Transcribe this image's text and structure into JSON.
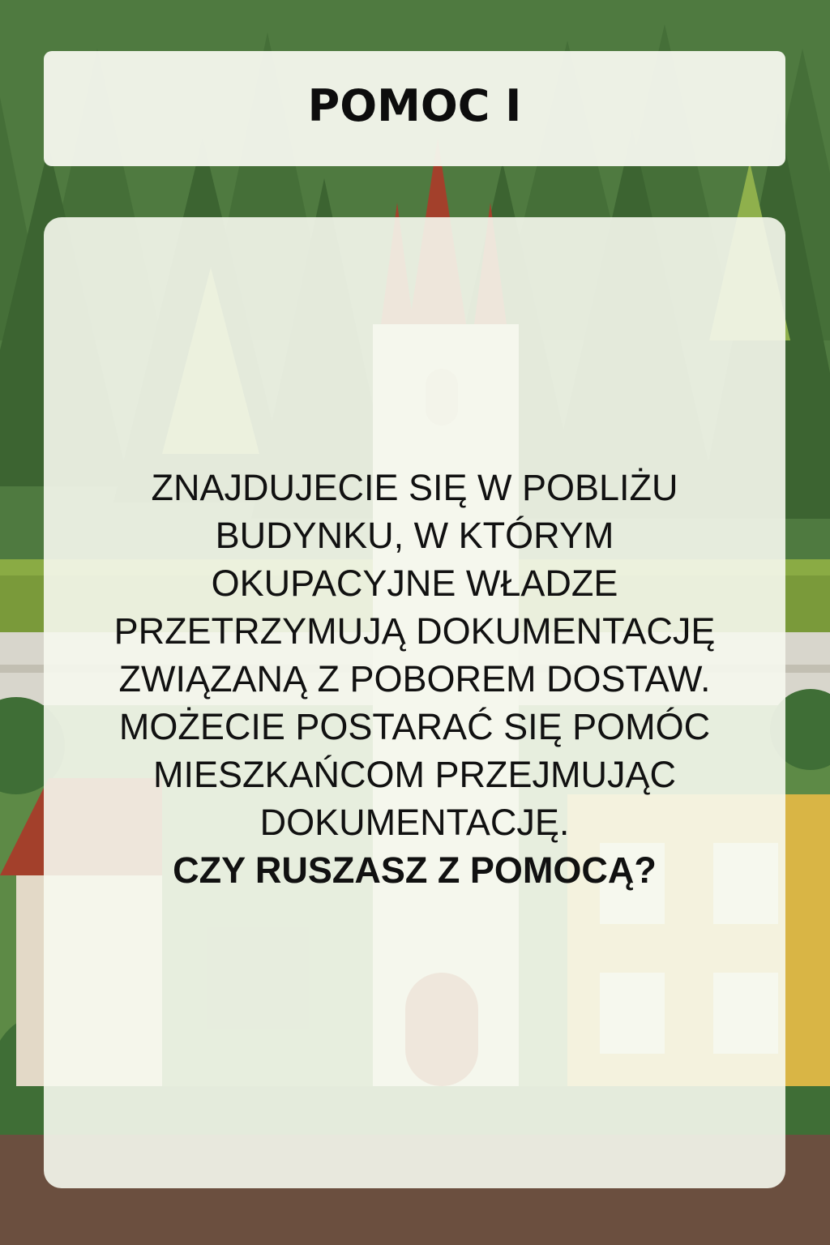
{
  "card": {
    "title": "POMOC I",
    "body": "ZNAJDUJECIE SIĘ W POBLIŻU BUDYNKU, W KTÓRYM OKUPACYJNE WŁADZE PRZETRZYMUJĄ DOKUMENTACJĘ ZWIĄZANĄ Z POBOREM DOSTAW. MOŻECIE POSTARAĆ SIĘ POMÓC MIESZKAŃCOM PRZEJMUJĄC DOKUMENTACJĘ.",
    "question": "CZY RUSZASZ Z POMOCĄ?"
  },
  "background": {
    "description_icons": [
      "pine-tree-icon",
      "church-tower-icon",
      "house-icon"
    ],
    "colors": {
      "forest": "#4f7a40",
      "tree_dark": "#3d6a33",
      "tree_light": "#7fa04a",
      "grass": "#7a9a3a",
      "road": "#d8d6cc",
      "spire": "#a3402b",
      "house_yellow": "#d9b545",
      "ground": "#6b4f3f"
    }
  }
}
